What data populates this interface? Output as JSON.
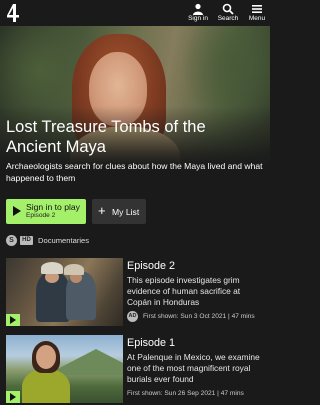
{
  "header": {
    "logo": "channel-4-logo",
    "signin_label": "Sign in",
    "search_label": "Search",
    "menu_label": "Menu"
  },
  "programme": {
    "title": "Lost Treasure Tombs of the Ancient Maya",
    "description": "Archaeologists search for clues about how the Maya lived and what happened to them",
    "play_label": "Sign in to play",
    "play_sublabel": "Episode 2",
    "mylist_icon": "+",
    "mylist_label": "My List",
    "rating": "S",
    "hd": "HD",
    "genre": "Documentaries"
  },
  "episodes": [
    {
      "title": "Episode 2",
      "description": "This episode investigates grim evidence of human sacrifice at Copán in Honduras",
      "ad_badge": "AD",
      "first_shown": "First shown: Sun 3 Oct 2021 | 47 mins"
    },
    {
      "title": "Episode 1",
      "description": "At Palenque in Mexico, we examine one of the most magnificent royal burials ever found",
      "first_shown": "First shown: Sun 26 Sep 2021 | 47 mins"
    }
  ],
  "colors": {
    "accent": "#a4f06a",
    "background": "#1a1a1a"
  }
}
